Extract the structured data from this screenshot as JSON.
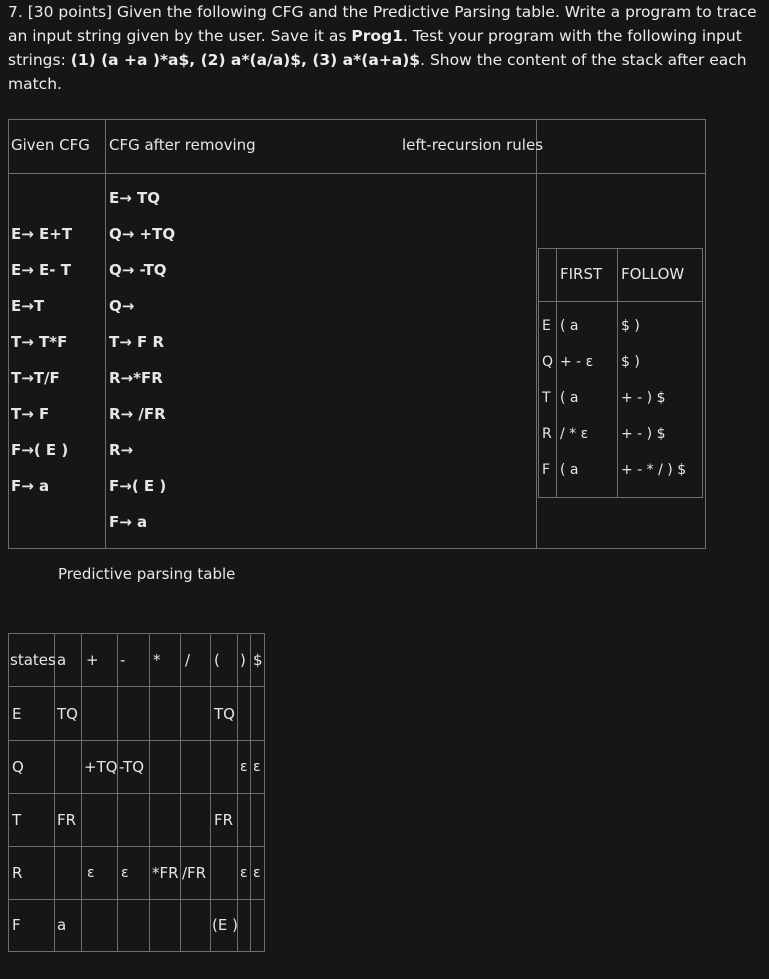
{
  "question": {
    "prefix": "7. [30 points] Given the following CFG and the Predictive Parsing table. Write a program to trace an input string given by the user. Save it as ",
    "program": "Prog1",
    "middle": ". Test your program with the following input strings: ",
    "inputs": "(1) (a +a )*a$, (2) a*(a/a)$, (3) a*(a+a)$",
    "suffix": ". Show the content of the stack after each match."
  },
  "cfg_table": {
    "header_given": "Given CFG",
    "header_after": "CFG after removing",
    "header_left": "left-recursion rules",
    "given_rules": [
      "E→ E+T",
      "E→ E- T",
      "E→T",
      "T→ T*F",
      "T→T/F",
      "T→ F",
      "F→( E )",
      "F→ a"
    ],
    "after_rules": [
      "E→ TQ",
      "Q→ +TQ",
      "Q→ -TQ",
      "Q→",
      "T→ F R",
      "R→*FR",
      "R→ /FR",
      "R→",
      "F→( E )",
      "F→ a"
    ]
  },
  "first_follow": {
    "header_first": "FIRST",
    "header_follow": "FOLLOW",
    "rows": [
      {
        "nt": "E",
        "first": "( a",
        "follow": "$ )"
      },
      {
        "nt": "Q",
        "first": "+ -  ε",
        "follow": "$ )"
      },
      {
        "nt": "T",
        "first": "( a",
        "follow": "+ - ) $"
      },
      {
        "nt": "R",
        "first": "/ *  ε",
        "follow": "+ - ) $"
      },
      {
        "nt": "F",
        "first": "( a",
        "follow": "+ - * / ) $"
      }
    ]
  },
  "parsing_table": {
    "title": "Predictive parsing table",
    "headers": [
      "states",
      "a",
      "+",
      "-",
      "*",
      "/",
      "(",
      ")",
      "$"
    ],
    "rows": [
      [
        "E",
        "TQ",
        "",
        "",
        "",
        "",
        "TQ",
        "",
        ""
      ],
      [
        "Q",
        "",
        "+TQ",
        "-TQ",
        "",
        "",
        "",
        "ε",
        "ε"
      ],
      [
        "T",
        "FR",
        "",
        "",
        "",
        "",
        "FR",
        "",
        ""
      ],
      [
        "R",
        "",
        "ε",
        "ε",
        "*FR",
        "/FR",
        "",
        "ε",
        "ε"
      ],
      [
        "F",
        "a",
        "",
        "",
        "",
        "",
        "(E )",
        "",
        ""
      ]
    ]
  }
}
